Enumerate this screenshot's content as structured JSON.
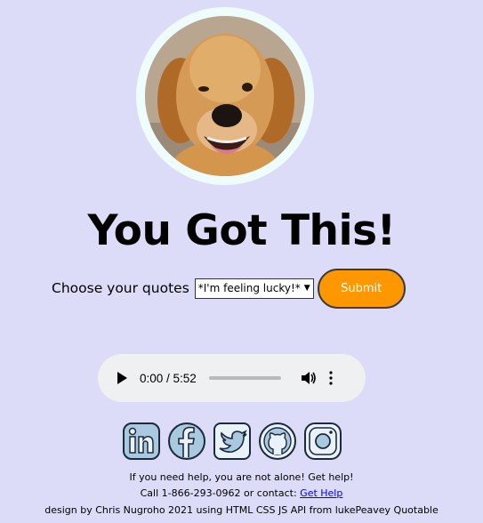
{
  "title": "You Got This!",
  "quote": {
    "label": "Choose your quotes",
    "selected": "*I'm feeling lucky!*",
    "submit_label": "Submit"
  },
  "audio": {
    "time": "0:00 / 5:52"
  },
  "socials": [
    "linkedin-icon",
    "facebook-icon",
    "twitter-icon",
    "github-icon",
    "instagram-icon"
  ],
  "footer": {
    "help_line": "If you need help, you are not alone! Get help!",
    "call_prefix": "Call 1-866-293-0962 or contact: ",
    "help_link": "Get Help",
    "credits": "design by Chris Nugroho 2021 using HTML CSS JS API from lukePeavey Quotable"
  },
  "colors": {
    "background": "#dcdcf8",
    "submit": "#ff9800",
    "ring": "#eefcfc",
    "social_fill": "#a9c9e0"
  }
}
